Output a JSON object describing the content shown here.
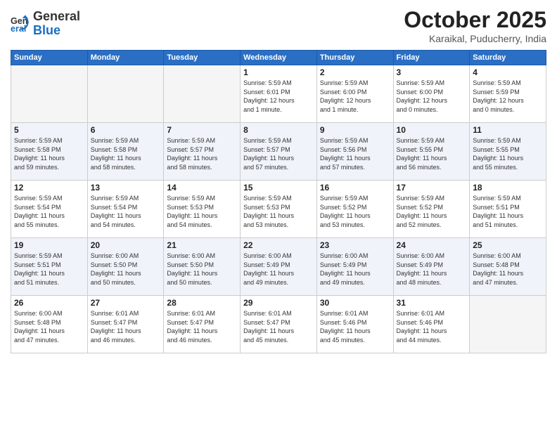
{
  "header": {
    "logo_general": "General",
    "logo_blue": "Blue",
    "month_title": "October 2025",
    "subtitle": "Karaikal, Puducherry, India"
  },
  "days_of_week": [
    "Sunday",
    "Monday",
    "Tuesday",
    "Wednesday",
    "Thursday",
    "Friday",
    "Saturday"
  ],
  "weeks": [
    [
      {
        "num": "",
        "info": ""
      },
      {
        "num": "",
        "info": ""
      },
      {
        "num": "",
        "info": ""
      },
      {
        "num": "1",
        "info": "Sunrise: 5:59 AM\nSunset: 6:01 PM\nDaylight: 12 hours\nand 1 minute."
      },
      {
        "num": "2",
        "info": "Sunrise: 5:59 AM\nSunset: 6:00 PM\nDaylight: 12 hours\nand 1 minute."
      },
      {
        "num": "3",
        "info": "Sunrise: 5:59 AM\nSunset: 6:00 PM\nDaylight: 12 hours\nand 0 minutes."
      },
      {
        "num": "4",
        "info": "Sunrise: 5:59 AM\nSunset: 5:59 PM\nDaylight: 12 hours\nand 0 minutes."
      }
    ],
    [
      {
        "num": "5",
        "info": "Sunrise: 5:59 AM\nSunset: 5:58 PM\nDaylight: 11 hours\nand 59 minutes."
      },
      {
        "num": "6",
        "info": "Sunrise: 5:59 AM\nSunset: 5:58 PM\nDaylight: 11 hours\nand 58 minutes."
      },
      {
        "num": "7",
        "info": "Sunrise: 5:59 AM\nSunset: 5:57 PM\nDaylight: 11 hours\nand 58 minutes."
      },
      {
        "num": "8",
        "info": "Sunrise: 5:59 AM\nSunset: 5:57 PM\nDaylight: 11 hours\nand 57 minutes."
      },
      {
        "num": "9",
        "info": "Sunrise: 5:59 AM\nSunset: 5:56 PM\nDaylight: 11 hours\nand 57 minutes."
      },
      {
        "num": "10",
        "info": "Sunrise: 5:59 AM\nSunset: 5:55 PM\nDaylight: 11 hours\nand 56 minutes."
      },
      {
        "num": "11",
        "info": "Sunrise: 5:59 AM\nSunset: 5:55 PM\nDaylight: 11 hours\nand 55 minutes."
      }
    ],
    [
      {
        "num": "12",
        "info": "Sunrise: 5:59 AM\nSunset: 5:54 PM\nDaylight: 11 hours\nand 55 minutes."
      },
      {
        "num": "13",
        "info": "Sunrise: 5:59 AM\nSunset: 5:54 PM\nDaylight: 11 hours\nand 54 minutes."
      },
      {
        "num": "14",
        "info": "Sunrise: 5:59 AM\nSunset: 5:53 PM\nDaylight: 11 hours\nand 54 minutes."
      },
      {
        "num": "15",
        "info": "Sunrise: 5:59 AM\nSunset: 5:53 PM\nDaylight: 11 hours\nand 53 minutes."
      },
      {
        "num": "16",
        "info": "Sunrise: 5:59 AM\nSunset: 5:52 PM\nDaylight: 11 hours\nand 53 minutes."
      },
      {
        "num": "17",
        "info": "Sunrise: 5:59 AM\nSunset: 5:52 PM\nDaylight: 11 hours\nand 52 minutes."
      },
      {
        "num": "18",
        "info": "Sunrise: 5:59 AM\nSunset: 5:51 PM\nDaylight: 11 hours\nand 51 minutes."
      }
    ],
    [
      {
        "num": "19",
        "info": "Sunrise: 5:59 AM\nSunset: 5:51 PM\nDaylight: 11 hours\nand 51 minutes."
      },
      {
        "num": "20",
        "info": "Sunrise: 6:00 AM\nSunset: 5:50 PM\nDaylight: 11 hours\nand 50 minutes."
      },
      {
        "num": "21",
        "info": "Sunrise: 6:00 AM\nSunset: 5:50 PM\nDaylight: 11 hours\nand 50 minutes."
      },
      {
        "num": "22",
        "info": "Sunrise: 6:00 AM\nSunset: 5:49 PM\nDaylight: 11 hours\nand 49 minutes."
      },
      {
        "num": "23",
        "info": "Sunrise: 6:00 AM\nSunset: 5:49 PM\nDaylight: 11 hours\nand 49 minutes."
      },
      {
        "num": "24",
        "info": "Sunrise: 6:00 AM\nSunset: 5:49 PM\nDaylight: 11 hours\nand 48 minutes."
      },
      {
        "num": "25",
        "info": "Sunrise: 6:00 AM\nSunset: 5:48 PM\nDaylight: 11 hours\nand 47 minutes."
      }
    ],
    [
      {
        "num": "26",
        "info": "Sunrise: 6:00 AM\nSunset: 5:48 PM\nDaylight: 11 hours\nand 47 minutes."
      },
      {
        "num": "27",
        "info": "Sunrise: 6:01 AM\nSunset: 5:47 PM\nDaylight: 11 hours\nand 46 minutes."
      },
      {
        "num": "28",
        "info": "Sunrise: 6:01 AM\nSunset: 5:47 PM\nDaylight: 11 hours\nand 46 minutes."
      },
      {
        "num": "29",
        "info": "Sunrise: 6:01 AM\nSunset: 5:47 PM\nDaylight: 11 hours\nand 45 minutes."
      },
      {
        "num": "30",
        "info": "Sunrise: 6:01 AM\nSunset: 5:46 PM\nDaylight: 11 hours\nand 45 minutes."
      },
      {
        "num": "31",
        "info": "Sunrise: 6:01 AM\nSunset: 5:46 PM\nDaylight: 11 hours\nand 44 minutes."
      },
      {
        "num": "",
        "info": ""
      }
    ]
  ]
}
